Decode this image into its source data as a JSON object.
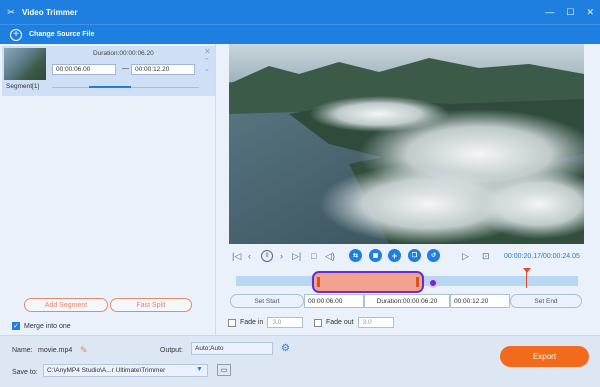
{
  "window": {
    "title": "Video Trimmer",
    "controls": [
      "—",
      "☐",
      "✕"
    ]
  },
  "toolbar": {
    "change_source": "Change Source File"
  },
  "segment": {
    "label": "Segment[1]",
    "duration": "Duration:00:00:06.20",
    "start": "00:00:06.00",
    "end": "00:00:12.20",
    "position_fraction": 0.5
  },
  "left_actions": {
    "add_segment": "Add Segment",
    "fast_split": "Fast Split",
    "merge_label": "Merge into one",
    "merge_checked": true
  },
  "player": {
    "current_time": "00:00:20.17",
    "total_time": "00:00:24.05",
    "time_display": "00:00:20.17/00:00:24.05",
    "controls": [
      "skip-start",
      "prev-frame",
      "pause",
      "next-frame",
      "skip-end",
      "stop",
      "volume",
      "dual-view",
      "snapshot",
      "add",
      "copy",
      "reset",
      "play-clip",
      "loop"
    ]
  },
  "timeline": {
    "selection_start_fraction": 0.25,
    "selection_end_fraction": 0.5,
    "playhead_fraction": 0.84
  },
  "trim": {
    "set_start": "Set Start",
    "start_value": "00:00:06.00",
    "duration_value": "Duration:00:00:06.20",
    "end_value": "00:00:12.20",
    "set_end": "Set End"
  },
  "fade": {
    "fade_in_label": "Fade in",
    "fade_in_value": "3.0",
    "fade_out_label": "Fade out",
    "fade_out_value": "3.0"
  },
  "bottom": {
    "name_label": "Name:",
    "name_value": "movie.mp4",
    "output_label": "Output:",
    "output_value": "Auto;Auto",
    "save_label": "Save to:",
    "save_path": "C:\\AnyMP4 Studio\\A...r Ultimate\\Trimmer",
    "export_label": "Export"
  },
  "colors": {
    "accent": "#1e7fe0",
    "export": "#f26a1b",
    "selection_border": "#6b2bd6",
    "selection_fill": "#f1a38f",
    "playhead": "#e34a2a"
  }
}
